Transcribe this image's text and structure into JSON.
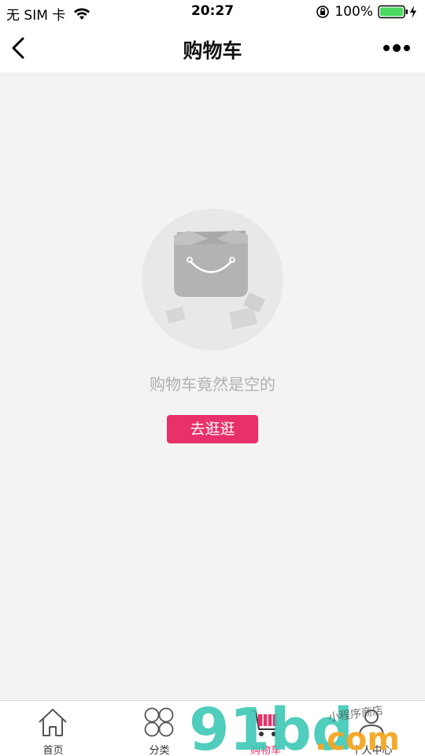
{
  "status_bar": {
    "carrier": "无 SIM 卡",
    "time": "20:27",
    "battery": "100%"
  },
  "nav": {
    "title": "购物车"
  },
  "empty_state": {
    "message": "购物车竟然是空的",
    "button_label": "去逛逛"
  },
  "tabs": [
    {
      "label": "首页",
      "icon": "home-icon"
    },
    {
      "label": "分类",
      "icon": "category-icon"
    },
    {
      "label": "购物车",
      "icon": "cart-icon"
    },
    {
      "label": "个人中心",
      "icon": "user-icon"
    }
  ],
  "colors": {
    "accent": "#e8306a",
    "watermark_teal": "#3ec8b5",
    "watermark_orange": "#f5a623"
  },
  "watermark": {
    "brand": "91bd",
    "domain": ".com",
    "tagline": "小程序商店"
  }
}
